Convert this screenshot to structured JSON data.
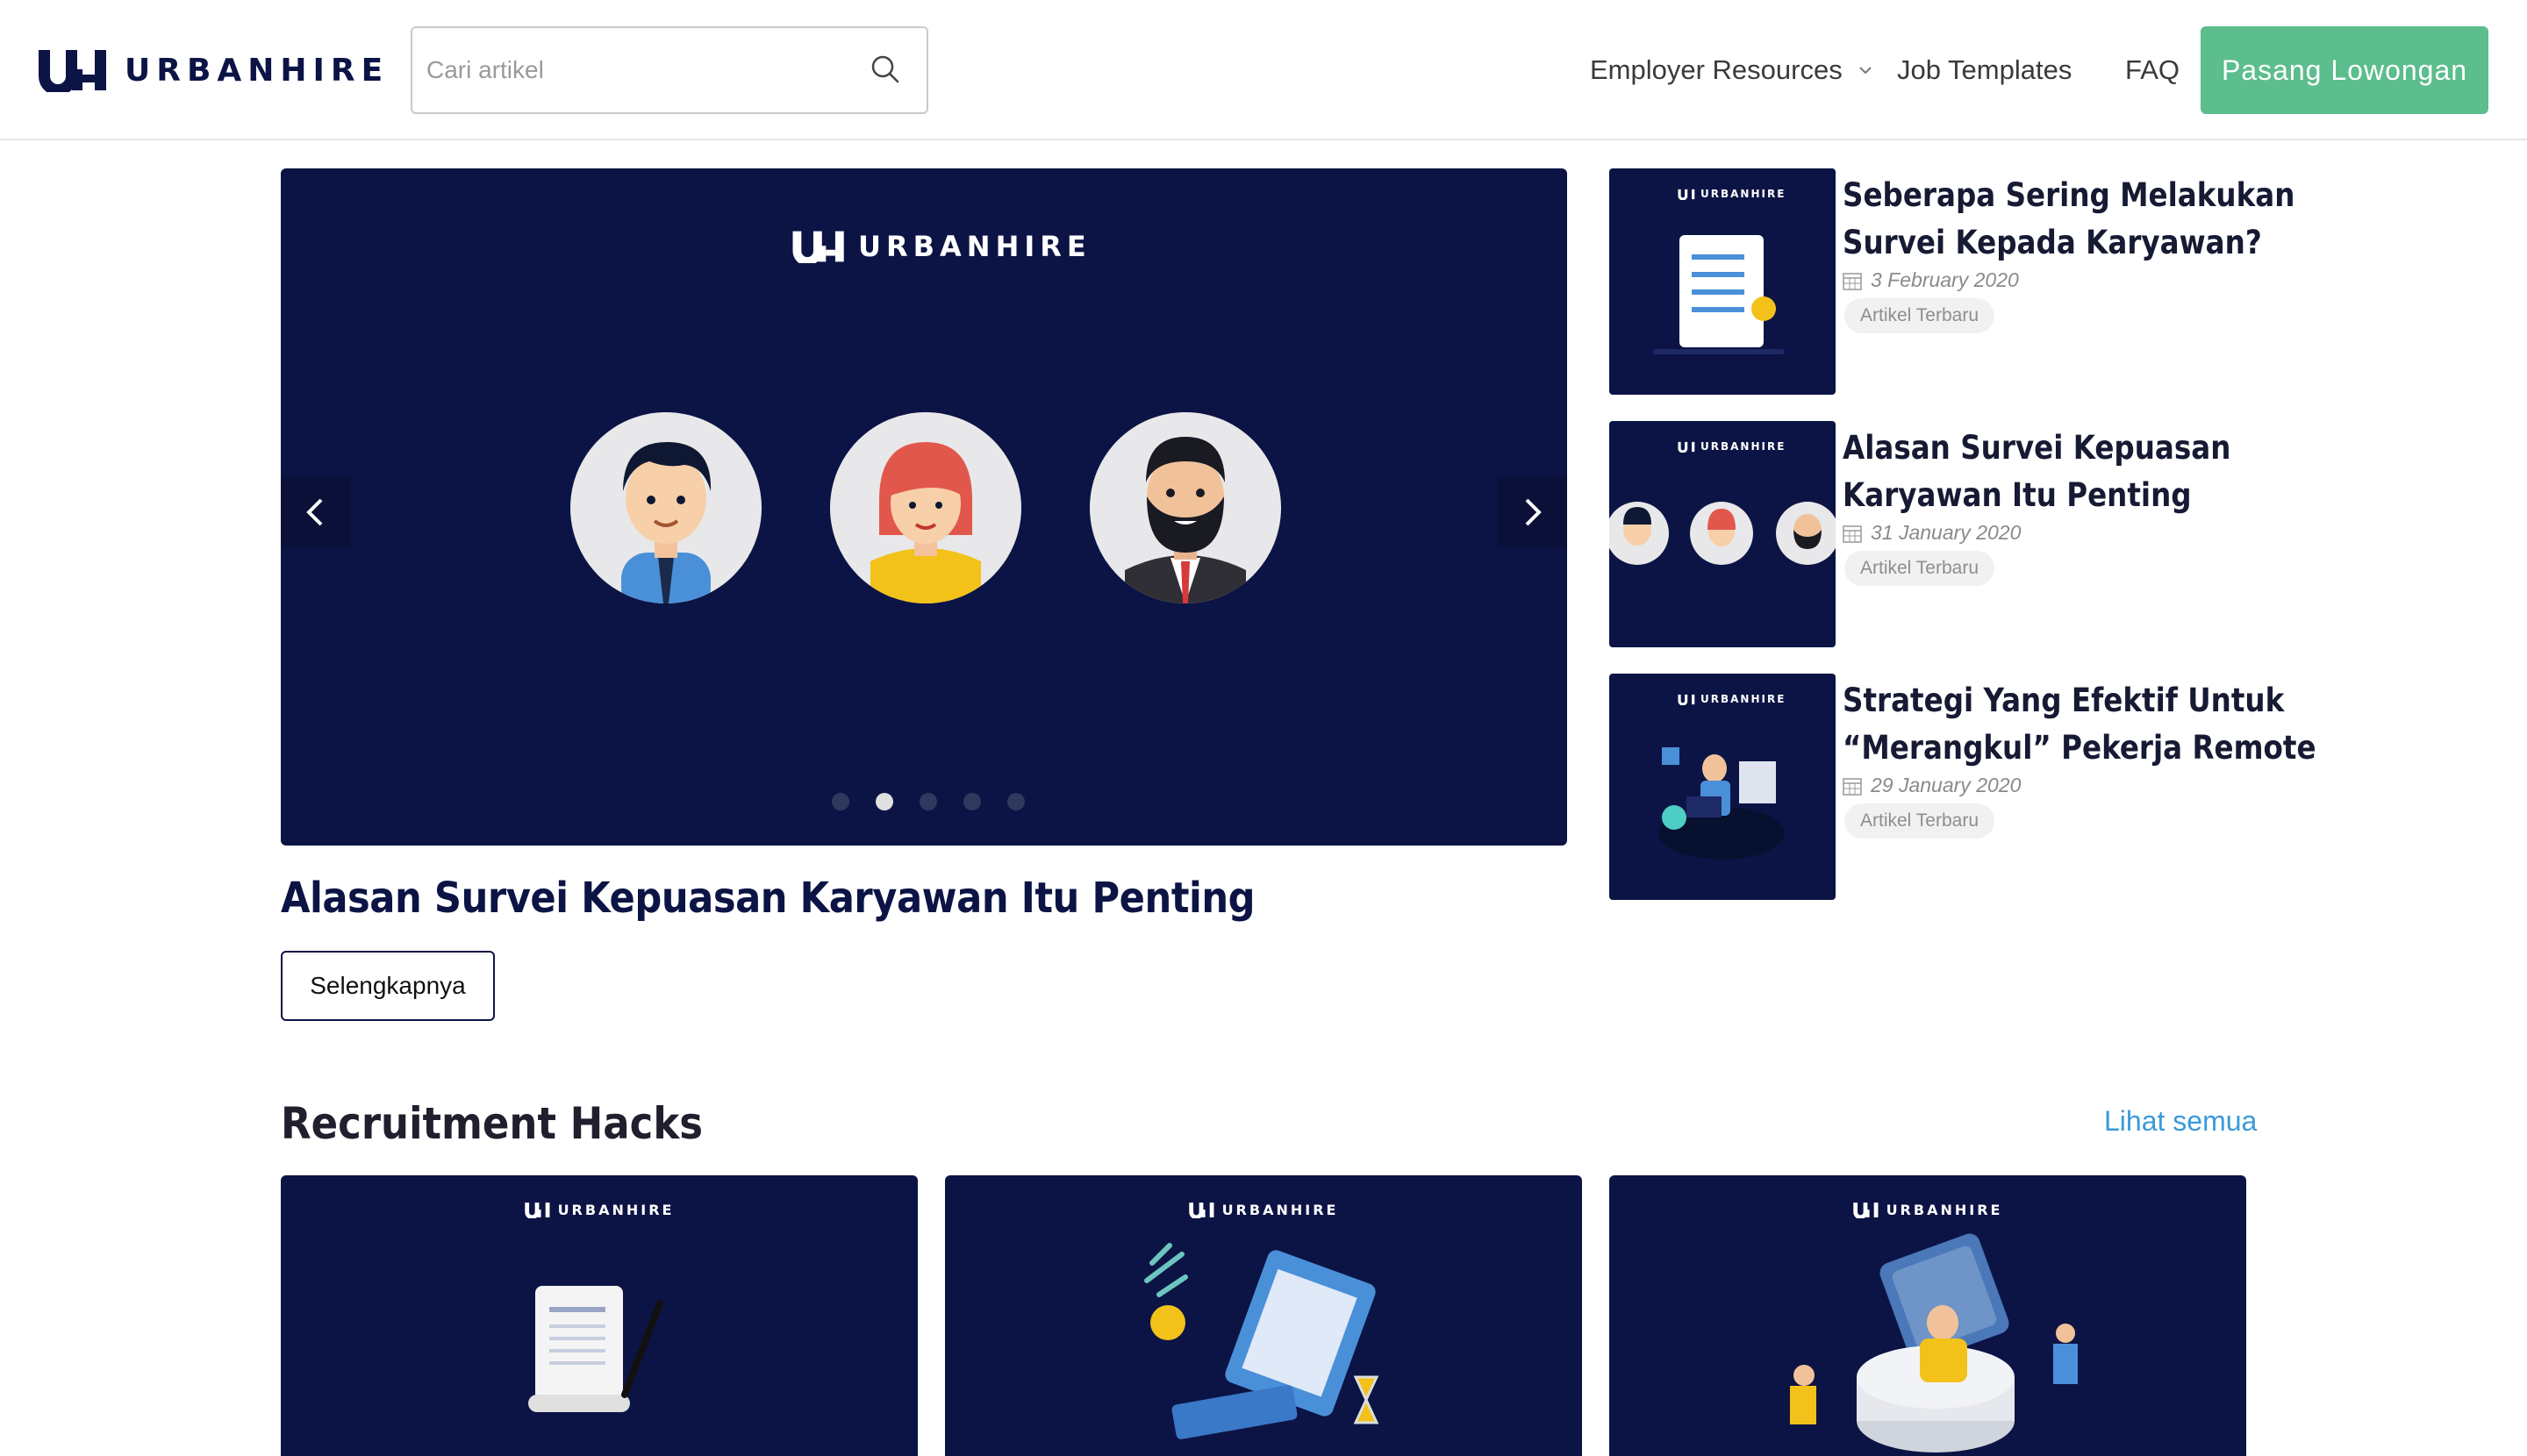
{
  "header": {
    "logo_text": "URBANHIRE",
    "search_placeholder": "Cari artikel",
    "nav": {
      "employer_resources": "Employer Resources",
      "job_templates": "Job Templates",
      "faq": "FAQ"
    },
    "post_job_button": "Pasang Lowongan"
  },
  "hero": {
    "slide_logo_text": "URBANHIRE",
    "title": "Alasan Survei Kepuasan Karyawan Itu Penting",
    "more_button": "Selengkapnya",
    "slide_count": 5,
    "active_slide": 2
  },
  "sidebar": {
    "items": [
      {
        "title_line1": "Seberapa Sering Melakukan",
        "title_line2": "Survei Kepada Karyawan?",
        "date": "3 February 2020",
        "tag": "Artikel Terbaru",
        "thumb_logo": "URBANHIRE"
      },
      {
        "title_line1": "Alasan Survei Kepuasan",
        "title_line2": "Karyawan Itu Penting",
        "date": "31 January 2020",
        "tag": "Artikel Terbaru",
        "thumb_logo": "URBANHIRE"
      },
      {
        "title_line1": "Strategi Yang Efektif Untuk",
        "title_line2": "“Merangkul” Pekerja Remote",
        "date": "29 January 2020",
        "tag": "Artikel Terbaru",
        "thumb_logo": "URBANHIRE"
      }
    ]
  },
  "section": {
    "title": "Recruitment Hacks",
    "see_all": "Lihat semua",
    "cards": [
      {
        "logo_text": "URBANHIRE"
      },
      {
        "logo_text": "URBANHIRE"
      },
      {
        "logo_text": "URBANHIRE"
      }
    ]
  },
  "colors": {
    "navy": "#0c1445",
    "green": "#5cbd8d",
    "link_blue": "#3a9ad9"
  }
}
